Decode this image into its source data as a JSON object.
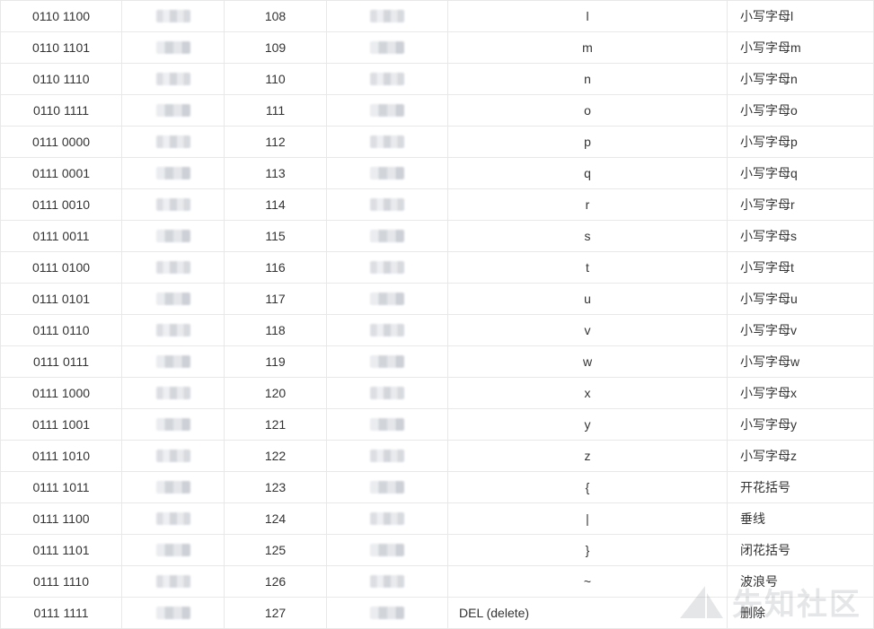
{
  "rows": [
    {
      "bin": "0110 1100",
      "dec": "108",
      "char": "l",
      "desc": "小写字母l"
    },
    {
      "bin": "0110 1101",
      "dec": "109",
      "char": "m",
      "desc": "小写字母m"
    },
    {
      "bin": "0110 1110",
      "dec": "110",
      "char": "n",
      "desc": "小写字母n"
    },
    {
      "bin": "0110 1111",
      "dec": "111",
      "char": "o",
      "desc": "小写字母o"
    },
    {
      "bin": "0111 0000",
      "dec": "112",
      "char": "p",
      "desc": "小写字母p"
    },
    {
      "bin": "0111 0001",
      "dec": "113",
      "char": "q",
      "desc": "小写字母q"
    },
    {
      "bin": "0111 0010",
      "dec": "114",
      "char": "r",
      "desc": "小写字母r"
    },
    {
      "bin": "0111 0011",
      "dec": "115",
      "char": "s",
      "desc": "小写字母s"
    },
    {
      "bin": "0111 0100",
      "dec": "116",
      "char": "t",
      "desc": "小写字母t"
    },
    {
      "bin": "0111 0101",
      "dec": "117",
      "char": "u",
      "desc": "小写字母u"
    },
    {
      "bin": "0111 0110",
      "dec": "118",
      "char": "v",
      "desc": "小写字母v"
    },
    {
      "bin": "0111 0111",
      "dec": "119",
      "char": "w",
      "desc": "小写字母w"
    },
    {
      "bin": "0111 1000",
      "dec": "120",
      "char": "x",
      "desc": "小写字母x"
    },
    {
      "bin": "0111 1001",
      "dec": "121",
      "char": "y",
      "desc": "小写字母y"
    },
    {
      "bin": "0111 1010",
      "dec": "122",
      "char": "z",
      "desc": "小写字母z"
    },
    {
      "bin": "0111 1011",
      "dec": "123",
      "char": "{",
      "desc": "开花括号"
    },
    {
      "bin": "0111 1100",
      "dec": "124",
      "char": "|",
      "desc": "垂线"
    },
    {
      "bin": "0111 1101",
      "dec": "125",
      "char": "}",
      "desc": "闭花括号"
    },
    {
      "bin": "0111 1110",
      "dec": "126",
      "char": "~",
      "desc": "波浪号"
    },
    {
      "bin": "0111 1111",
      "dec": "127",
      "char": "DEL (delete)",
      "desc": "删除"
    }
  ],
  "watermark": {
    "text": "先知社区"
  }
}
